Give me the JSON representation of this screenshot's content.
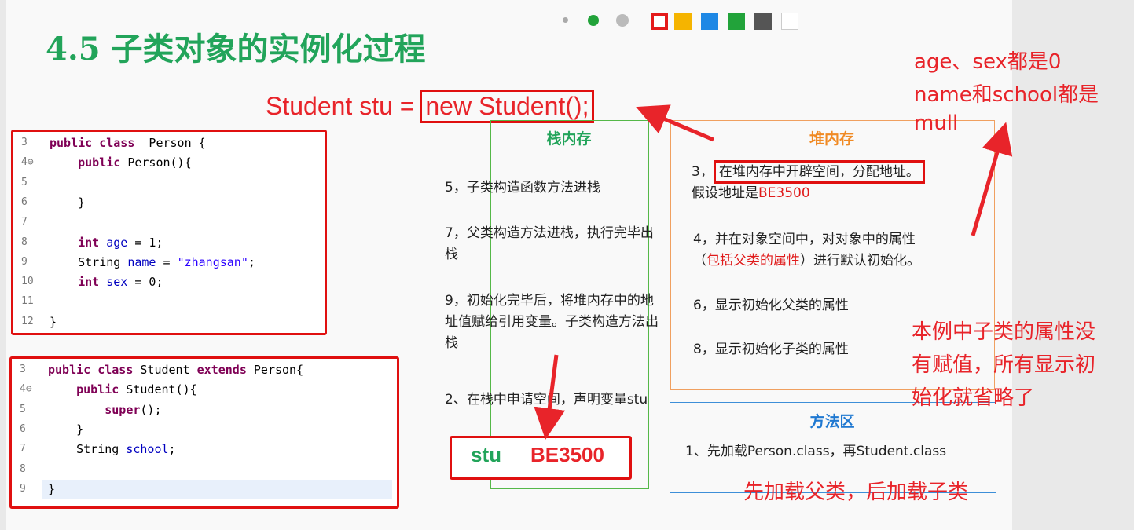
{
  "title": "4.5  子类对象的实例化过程",
  "toolbar": {
    "colors": [
      "#ffffff",
      "#e41a1a",
      "#f5b400",
      "#1e88e5",
      "#22a33a",
      "#555555",
      "#ffffff"
    ]
  },
  "statement": {
    "prefix": "Student stu = ",
    "highlight": "new Student();"
  },
  "person_code": {
    "line_numbers": [
      "3",
      "4⊖",
      "5",
      "6",
      "7",
      "8",
      "9",
      "10",
      "11",
      "12"
    ],
    "lines": [
      {
        "parts": [
          [
            "kw",
            "public class"
          ],
          [
            "",
            "  Person {"
          ]
        ]
      },
      {
        "parts": [
          [
            "",
            "    "
          ],
          [
            "kw",
            "public"
          ],
          [
            "",
            " Person(){"
          ]
        ]
      },
      {
        "parts": [
          [
            "",
            ""
          ]
        ]
      },
      {
        "parts": [
          [
            "",
            "    }"
          ]
        ]
      },
      {
        "parts": [
          [
            "",
            ""
          ]
        ]
      },
      {
        "parts": [
          [
            "",
            "    "
          ],
          [
            "kw",
            "int"
          ],
          [
            "",
            " "
          ],
          [
            "var",
            "age"
          ],
          [
            "",
            " = 1;"
          ]
        ]
      },
      {
        "parts": [
          [
            "",
            "    String "
          ],
          [
            "var",
            "name"
          ],
          [
            "",
            " = "
          ],
          [
            "str",
            "\"zhangsan\""
          ],
          [
            "",
            ";"
          ]
        ]
      },
      {
        "parts": [
          [
            "",
            "    "
          ],
          [
            "kw",
            "int"
          ],
          [
            "",
            " "
          ],
          [
            "var",
            "sex"
          ],
          [
            "",
            " = 0;"
          ]
        ]
      },
      {
        "parts": [
          [
            "",
            ""
          ]
        ]
      },
      {
        "parts": [
          [
            "",
            "}"
          ]
        ]
      }
    ]
  },
  "student_code": {
    "line_numbers": [
      "3",
      "4⊖",
      "5",
      "6",
      "7",
      "8",
      "9"
    ],
    "lines": [
      {
        "parts": [
          [
            "kw",
            "public class"
          ],
          [
            "",
            " Student "
          ],
          [
            "kw",
            "extends"
          ],
          [
            "",
            " Person{"
          ]
        ]
      },
      {
        "parts": [
          [
            "",
            "    "
          ],
          [
            "kw",
            "public"
          ],
          [
            "",
            " Student(){"
          ]
        ]
      },
      {
        "parts": [
          [
            "",
            "        "
          ],
          [
            "kw",
            "super"
          ],
          [
            "",
            "();"
          ]
        ]
      },
      {
        "parts": [
          [
            "",
            "    }"
          ]
        ]
      },
      {
        "parts": [
          [
            "",
            "    String "
          ],
          [
            "var",
            "school"
          ],
          [
            "",
            ";"
          ]
        ]
      },
      {
        "parts": [
          [
            "",
            ""
          ]
        ]
      },
      {
        "parts": [
          [
            "",
            "}"
          ]
        ]
      }
    ]
  },
  "stack": {
    "title": "栈内存",
    "step5": "5，子类构造函数方法进栈",
    "step7": "7，父类构造方法进栈，执行完毕出栈",
    "step9": "9，初始化完毕后，将堆内存中的地址值赋给引用变量。子类构造方法出栈",
    "step2": "2、在栈中申请空间，声明变量stu",
    "var_name": "stu",
    "var_value": "BE3500"
  },
  "heap": {
    "title": "堆内存",
    "step3_prefix": "3，",
    "step3_box": "在堆内存中开辟空间，分配地址。",
    "step3_suffix": "假设地址是",
    "step3_addr": "BE3500",
    "step4_a": "4，并在对象空间中，对对象中的属性",
    "step4_red": "包括父类的属性",
    "step4_b": "进行默认初始化。",
    "step6": "6，显示初始化父类的属性",
    "step8": "8，显示初始化子类的属性"
  },
  "method_area": {
    "title": "方法区",
    "step1": "1、先加载Person.class，再Student.class"
  },
  "annotations": {
    "defaults_1": "age、sex都是0",
    "defaults_2": "name和school都是",
    "defaults_3": "mull",
    "no_assign_1": "本例中子类的属性没",
    "no_assign_2": "有赋值，所有显示初",
    "no_assign_3": "始化就省略了",
    "load_order": "先加载父类，后加载子类"
  }
}
